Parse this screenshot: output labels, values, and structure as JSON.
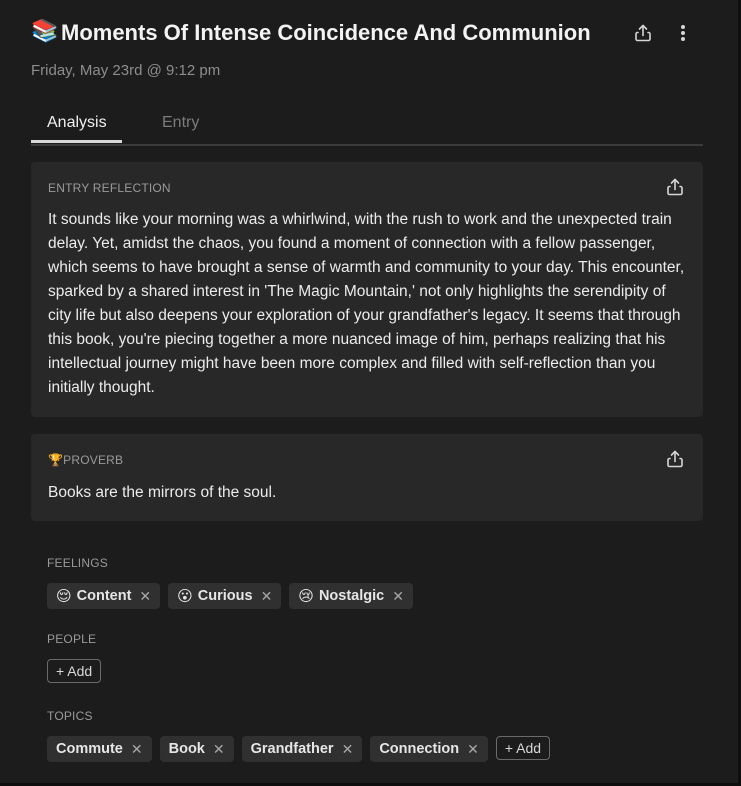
{
  "header": {
    "emoji": "📚",
    "title": "Moments Of Intense Coincidence And Communion",
    "date": "Friday, May 23rd @ 9:12 pm",
    "share_icon": "share-icon",
    "more_icon": "more-vertical-icon"
  },
  "tabs": [
    {
      "label": "Analysis",
      "active": true
    },
    {
      "label": "Entry",
      "active": false
    }
  ],
  "reflection": {
    "label": "ENTRY REFLECTION",
    "body": "It sounds like your morning was a whirlwind, with the rush to work and the unexpected train delay. Yet, amidst the chaos, you found a moment of connection with a fellow passenger, which seems to have brought a sense of warmth and community to your day. This encounter, sparked by a shared interest in 'The Magic Mountain,' not only highlights the serendipity of city life but also deepens your exploration of your grandfather's legacy. It seems that through this book, you're piecing together a more nuanced image of him, perhaps realizing that his intellectual journey might have been more complex and filled with self-reflection than you initially thought."
  },
  "proverb": {
    "emoji": "🏆",
    "label": "PROVERB",
    "body": "Books are the mirrors of the soul."
  },
  "feelings": {
    "label": "FEELINGS",
    "items": [
      {
        "emoji": "😌",
        "label": "Content"
      },
      {
        "emoji": "😮",
        "label": "Curious"
      },
      {
        "emoji": "😢",
        "label": "Nostalgic"
      }
    ],
    "remove_glyph": "✕"
  },
  "people": {
    "label": "PEOPLE",
    "add_label": "+ Add"
  },
  "topics": {
    "label": "TOPICS",
    "items": [
      "Commute",
      "Book",
      "Grandfather",
      "Connection"
    ],
    "add_label": "+ Add"
  },
  "colors": {
    "background": "#1c1c1c",
    "card": "#282828",
    "chip": "#303030",
    "muted_text": "#8d8d8d"
  }
}
